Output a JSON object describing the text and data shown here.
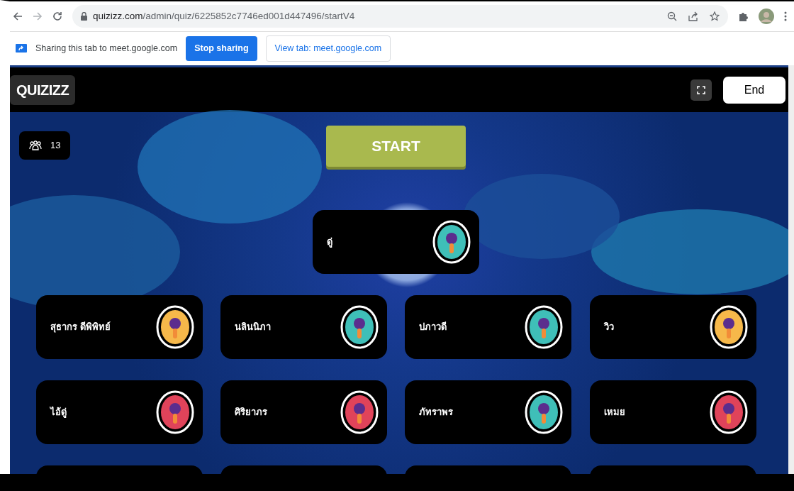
{
  "browser": {
    "url_host": "quizizz.com",
    "url_path": "/admin/quiz/6225852c7746ed001d447496/startV4"
  },
  "sharing_bar": {
    "message": "Sharing this tab to meet.google.com",
    "stop_button": "Stop sharing",
    "view_button": "View tab: meet.google.com"
  },
  "header": {
    "logo": "QUIZIZZ",
    "end_button": "End"
  },
  "player_count": "13",
  "start_button": "START",
  "featured_player": {
    "name": "ดู่",
    "color": "#3fbfb8"
  },
  "players": [
    {
      "name": "สุธากร ดีพิพิทย์",
      "color": "#f6b84a"
    },
    {
      "name": "นลินนิภา",
      "color": "#3fbfb8"
    },
    {
      "name": "ปภาวดี",
      "color": "#3fbfb8"
    },
    {
      "name": "วิว",
      "color": "#f6b84a"
    },
    {
      "name": "ไอ้ดู่",
      "color": "#e0435a"
    },
    {
      "name": "ศิริยาภร",
      "color": "#e0435a"
    },
    {
      "name": "ภัทราพร",
      "color": "#3fbfb8"
    },
    {
      "name": "เหมย",
      "color": "#e0435a"
    }
  ]
}
